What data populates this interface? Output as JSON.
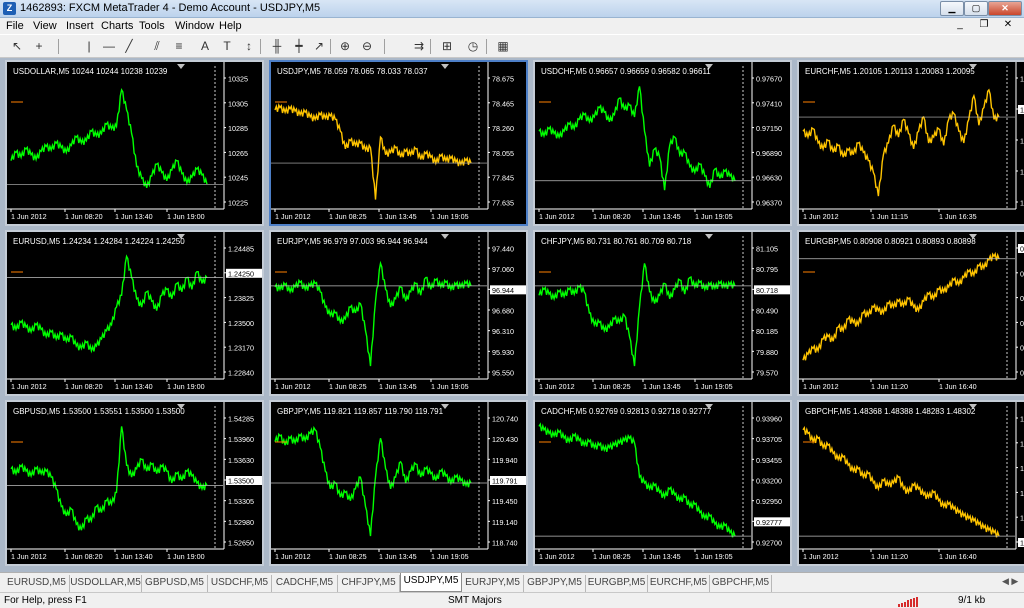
{
  "window": {
    "title": "1462893: FXCM MetaTrader 4 - Demo Account - USDJPY,M5",
    "icon": "metatrader-app-icon",
    "controls": [
      "minimize",
      "maximize",
      "close"
    ]
  },
  "menu": [
    "File",
    "View",
    "Insert",
    "Charts",
    "Tools",
    "Window",
    "Help"
  ],
  "toolbar": {
    "tools": [
      "cursor",
      "crosshair",
      "vertical-line",
      "horizontal-line",
      "trendline",
      "equidistant-channel",
      "fibonacci",
      "text",
      "text-label",
      "arrows",
      "bar-chart",
      "candlesticks",
      "line-chart",
      "zoom-in",
      "zoom-out",
      "autoscroll",
      "new-order",
      "periods",
      "templates"
    ],
    "icons": {
      "cursor": "↖",
      "crosshair": "+",
      "vertical-line": "|",
      "horizontal-line": "—",
      "trendline": "╱",
      "equidistant-channel": "⫽",
      "fibonacci": "≡",
      "text": "A",
      "text-label": "T",
      "arrows": "↕",
      "bar-chart": "╫",
      "candlesticks": "┿",
      "line-chart": "↗",
      "zoom-in": "⊕",
      "zoom-out": "⊖",
      "autoscroll": "⇉",
      "new-order": "⊞",
      "periods": "◷",
      "templates": "▦"
    }
  },
  "colors": {
    "chart_bg": "#000000",
    "up_series": "#00ff00",
    "yellow_series": "#ffc400",
    "axis_text": "#ffffff",
    "grid_line": "#c0c0c0"
  },
  "charts": [
    {
      "symbol": "USDOLLAR,M5",
      "ohlc": "10244 10244 10238 10239",
      "color": "green",
      "price_labels": [
        "10325",
        "10305",
        "10285",
        "10265",
        "10245",
        "10225"
      ],
      "current": "10239",
      "time_labels": [
        "1 Jun 2012",
        "1 Jun 08:20",
        "1 Jun 13:40",
        "1 Jun 19:00"
      ],
      "series": [
        0.35,
        0.42,
        0.38,
        0.45,
        0.4,
        0.36,
        0.43,
        0.47,
        0.44,
        0.5,
        0.46,
        0.42,
        0.48,
        0.55,
        0.5,
        0.52,
        0.6,
        0.56,
        0.58,
        0.66,
        0.62,
        0.64,
        0.95,
        0.78,
        0.58,
        0.3,
        0.2,
        0.12,
        0.22,
        0.32,
        0.25,
        0.18,
        0.27,
        0.35,
        0.24,
        0.16,
        0.21,
        0.28,
        0.23,
        0.15
      ]
    },
    {
      "symbol": "USDJPY,M5",
      "ohlc": "78.059 78.065 78.033 78.037",
      "color": "yellow",
      "price_labels": [
        "78.675",
        "78.465",
        "78.260",
        "78.055",
        "77.845",
        "77.635"
      ],
      "current": "78.037",
      "time_labels": [
        "1 Jun 2012",
        "1 Jun 08:25",
        "1 Jun 13:45",
        "1 Jun 19:05"
      ],
      "series": [
        0.78,
        0.8,
        0.76,
        0.79,
        0.77,
        0.74,
        0.76,
        0.72,
        0.7,
        0.74,
        0.71,
        0.73,
        0.7,
        0.6,
        0.45,
        0.52,
        0.48,
        0.5,
        0.44,
        0.46,
        0.02,
        0.55,
        0.4,
        0.42,
        0.46,
        0.38,
        0.43,
        0.4,
        0.45,
        0.36,
        0.41,
        0.38,
        0.33,
        0.39,
        0.35,
        0.37,
        0.34,
        0.32,
        0.35,
        0.33
      ]
    },
    {
      "symbol": "USDCHF,M5",
      "ohlc": "0.96657 0.96659 0.96582 0.96611",
      "color": "green",
      "price_labels": [
        "0.97670",
        "0.97410",
        "0.97150",
        "0.96890",
        "0.96630",
        "0.96370"
      ],
      "current": "0.96611",
      "time_labels": [
        "1 Jun 2012",
        "1 Jun 08:20",
        "1 Jun 13:45",
        "1 Jun 19:05"
      ],
      "series": [
        0.6,
        0.56,
        0.62,
        0.58,
        0.55,
        0.6,
        0.66,
        0.62,
        0.7,
        0.74,
        0.68,
        0.72,
        0.8,
        0.76,
        0.68,
        0.74,
        0.88,
        0.78,
        0.82,
        0.72,
        0.98,
        0.6,
        0.3,
        0.45,
        0.38,
        0.1,
        0.48,
        0.55,
        0.4,
        0.42,
        0.3,
        0.25,
        0.32,
        0.22,
        0.12,
        0.28,
        0.2,
        0.26,
        0.22,
        0.18
      ]
    },
    {
      "symbol": "EURCHF,M5",
      "ohlc": "1.20105 1.20113 1.20083 1.20095",
      "color": "yellow",
      "price_labels": [
        "1.20120",
        "1.20095",
        "1.20075",
        "1.20055",
        "1.20035"
      ],
      "current": "1.20095",
      "time_labels": [
        "1 Jun 2012",
        "1 Jun 11:15",
        "1 Jun 16:35"
      ],
      "series": [
        0.6,
        0.55,
        0.62,
        0.5,
        0.45,
        0.52,
        0.42,
        0.48,
        0.38,
        0.44,
        0.4,
        0.5,
        0.42,
        0.35,
        0.25,
        0.05,
        0.4,
        0.5,
        0.65,
        0.55,
        0.7,
        0.58,
        0.45,
        0.6,
        0.72,
        0.5,
        0.55,
        0.62,
        0.48,
        0.7,
        0.75,
        0.6,
        0.5,
        0.7,
        0.9,
        0.65,
        0.8,
        0.95,
        0.7,
        0.72
      ]
    },
    {
      "symbol": "EURUSD,M5",
      "ohlc": "1.24234 1.24284 1.24224 1.24250",
      "color": "green",
      "price_labels": [
        "1.24485",
        "1.24250",
        "1.23825",
        "1.23500",
        "1.23170",
        "1.22840"
      ],
      "current": "1.24250",
      "time_labels": [
        "1 Jun 2012",
        "1 Jun 08:20",
        "1 Jun 13:40",
        "1 Jun 19:00"
      ],
      "series": [
        0.4,
        0.36,
        0.42,
        0.38,
        0.34,
        0.4,
        0.36,
        0.3,
        0.34,
        0.28,
        0.32,
        0.26,
        0.3,
        0.22,
        0.2,
        0.25,
        0.18,
        0.22,
        0.28,
        0.35,
        0.4,
        0.55,
        0.65,
        0.98,
        0.8,
        0.62,
        0.55,
        0.68,
        0.6,
        0.52,
        0.65,
        0.7,
        0.62,
        0.75,
        0.68,
        0.8,
        0.7,
        0.85,
        0.75,
        0.8
      ]
    },
    {
      "symbol": "EURJPY,M5",
      "ohlc": "96.979 97.003 96.944 96.944",
      "color": "green",
      "price_labels": [
        "97.440",
        "97.060",
        "96.944",
        "96.680",
        "96.310",
        "95.930",
        "95.550"
      ],
      "current": "96.944",
      "time_labels": [
        "1 Jun 2012",
        "1 Jun 08:25",
        "1 Jun 13:45",
        "1 Jun 19:05"
      ],
      "series": [
        0.72,
        0.7,
        0.74,
        0.68,
        0.72,
        0.76,
        0.7,
        0.73,
        0.75,
        0.68,
        0.55,
        0.48,
        0.5,
        0.42,
        0.45,
        0.55,
        0.5,
        0.58,
        0.35,
        0.05,
        0.6,
        0.92,
        0.7,
        0.55,
        0.62,
        0.72,
        0.6,
        0.68,
        0.75,
        0.65,
        0.8,
        0.7,
        0.78,
        0.72,
        0.76,
        0.7,
        0.74,
        0.72,
        0.75,
        0.73
      ]
    },
    {
      "symbol": "CHFJPY,M5",
      "ohlc": "80.731 80.761 80.709 80.718",
      "color": "green",
      "price_labels": [
        "81.105",
        "80.795",
        "80.718",
        "80.490",
        "80.185",
        "79.880",
        "79.570"
      ],
      "current": "80.718",
      "time_labels": [
        "1 Jun 2012",
        "1 Jun 08:25",
        "1 Jun 13:45",
        "1 Jun 19:05"
      ],
      "series": [
        0.65,
        0.7,
        0.66,
        0.62,
        0.68,
        0.64,
        0.7,
        0.66,
        0.72,
        0.68,
        0.5,
        0.4,
        0.42,
        0.35,
        0.38,
        0.45,
        0.42,
        0.48,
        0.3,
        0.05,
        0.55,
        0.92,
        0.68,
        0.58,
        0.65,
        0.75,
        0.62,
        0.7,
        0.78,
        0.66,
        0.8,
        0.72,
        0.76,
        0.7,
        0.74,
        0.71,
        0.75,
        0.72,
        0.74,
        0.73
      ]
    },
    {
      "symbol": "EURGBP,M5",
      "ohlc": "0.80908 0.80921 0.80893 0.80898",
      "color": "yellow",
      "price_labels": [
        "0.80898",
        "0.80780",
        "0.80645",
        "0.80505",
        "0.80370",
        "0.80230"
      ],
      "current": "0.80898",
      "time_labels": [
        "1 Jun 2012",
        "1 Jun 11:20",
        "1 Jun 16:40"
      ],
      "series": [
        0.1,
        0.15,
        0.2,
        0.18,
        0.28,
        0.3,
        0.26,
        0.38,
        0.35,
        0.45,
        0.42,
        0.4,
        0.5,
        0.48,
        0.55,
        0.52,
        0.5,
        0.58,
        0.55,
        0.6,
        0.56,
        0.62,
        0.55,
        0.52,
        0.6,
        0.66,
        0.62,
        0.7,
        0.68,
        0.72,
        0.78,
        0.74,
        0.8,
        0.85,
        0.82,
        0.9,
        0.88,
        0.95,
        0.98,
        0.96
      ]
    },
    {
      "symbol": "GBPUSD,M5",
      "ohlc": "1.53500 1.53551 1.53500 1.53500",
      "color": "green",
      "price_labels": [
        "1.54285",
        "1.53960",
        "1.53630",
        "1.53500",
        "1.53305",
        "1.52980",
        "1.52650"
      ],
      "current": "1.53500",
      "time_labels": [
        "1 Jun 2012",
        "1 Jun 08:20",
        "1 Jun 13:40",
        "1 Jun 19:00"
      ],
      "series": [
        0.62,
        0.58,
        0.64,
        0.6,
        0.56,
        0.62,
        0.58,
        0.6,
        0.55,
        0.45,
        0.3,
        0.22,
        0.28,
        0.15,
        0.1,
        0.2,
        0.18,
        0.3,
        0.25,
        0.35,
        0.32,
        0.42,
        0.98,
        0.65,
        0.55,
        0.62,
        0.7,
        0.6,
        0.66,
        0.58,
        0.64,
        0.6,
        0.5,
        0.58,
        0.52,
        0.6,
        0.56,
        0.5,
        0.45,
        0.48
      ]
    },
    {
      "symbol": "GBPJPY,M5",
      "ohlc": "119.821 119.857 119.790 119.791",
      "color": "green",
      "price_labels": [
        "120.740",
        "120.430",
        "119.940",
        "119.791",
        "119.450",
        "119.140",
        "118.740"
      ],
      "current": "119.791",
      "time_labels": [
        "1 Jun 2012",
        "1 Jun 08:25",
        "1 Jun 13:45",
        "1 Jun 19:05"
      ],
      "series": [
        0.85,
        0.9,
        0.82,
        0.88,
        0.84,
        0.9,
        0.86,
        0.92,
        0.95,
        0.8,
        0.6,
        0.45,
        0.5,
        0.38,
        0.42,
        0.35,
        0.45,
        0.55,
        0.3,
        0.05,
        0.55,
        0.88,
        0.62,
        0.45,
        0.55,
        0.68,
        0.5,
        0.6,
        0.66,
        0.55,
        0.62,
        0.58,
        0.52,
        0.6,
        0.56,
        0.5,
        0.55,
        0.52,
        0.48,
        0.5
      ]
    },
    {
      "symbol": "CADCHF,M5",
      "ohlc": "0.92769 0.92813 0.92718 0.92777",
      "color": "green",
      "price_labels": [
        "0.93960",
        "0.93705",
        "0.93455",
        "0.93200",
        "0.92950",
        "0.92777",
        "0.92700"
      ],
      "current": "0.92777",
      "time_labels": [
        "1 Jun 2012",
        "1 Jun 08:25",
        "1 Jun 13:45",
        "1 Jun 19:05"
      ],
      "series": [
        0.98,
        0.95,
        0.92,
        0.9,
        0.93,
        0.88,
        0.85,
        0.9,
        0.86,
        0.82,
        0.85,
        0.8,
        0.82,
        0.78,
        0.8,
        0.82,
        0.84,
        0.86,
        0.88,
        0.84,
        0.55,
        0.5,
        0.45,
        0.48,
        0.42,
        0.38,
        0.45,
        0.4,
        0.35,
        0.38,
        0.3,
        0.32,
        0.25,
        0.2,
        0.22,
        0.15,
        0.12,
        0.14,
        0.08,
        0.05
      ]
    },
    {
      "symbol": "GBPCHF,M5",
      "ohlc": "1.48368 1.48388 1.48283 1.48302",
      "color": "yellow",
      "price_labels": [
        "1.49600",
        "1.49330",
        "1.49065",
        "1.48795",
        "1.48525",
        "1.48302"
      ],
      "current": "1.48302",
      "time_labels": [
        "1 Jun 2012",
        "1 Jun 11:20",
        "1 Jun 16:40"
      ],
      "series": [
        0.95,
        0.92,
        0.85,
        0.88,
        0.8,
        0.82,
        0.75,
        0.7,
        0.72,
        0.65,
        0.6,
        0.62,
        0.55,
        0.58,
        0.5,
        0.45,
        0.52,
        0.48,
        0.5,
        0.55,
        0.45,
        0.42,
        0.48,
        0.45,
        0.4,
        0.38,
        0.42,
        0.35,
        0.3,
        0.32,
        0.28,
        0.25,
        0.22,
        0.2,
        0.18,
        0.15,
        0.12,
        0.1,
        0.08,
        0.05
      ]
    }
  ],
  "tabs": [
    "EURUSD,M5",
    "USDOLLAR,M5",
    "GBPUSD,M5",
    "USDCHF,M5",
    "CADCHF,M5",
    "CHFJPY,M5",
    "USDJPY,M5",
    "EURJPY,M5",
    "GBPJPY,M5",
    "EURGBP,M5",
    "EURCHF,M5",
    "GBPCHF,M5"
  ],
  "active_tab": "USDJPY,M5",
  "status": {
    "help": "For Help, press F1",
    "profile": "SMT Majors",
    "traffic": "9/1 kb"
  }
}
